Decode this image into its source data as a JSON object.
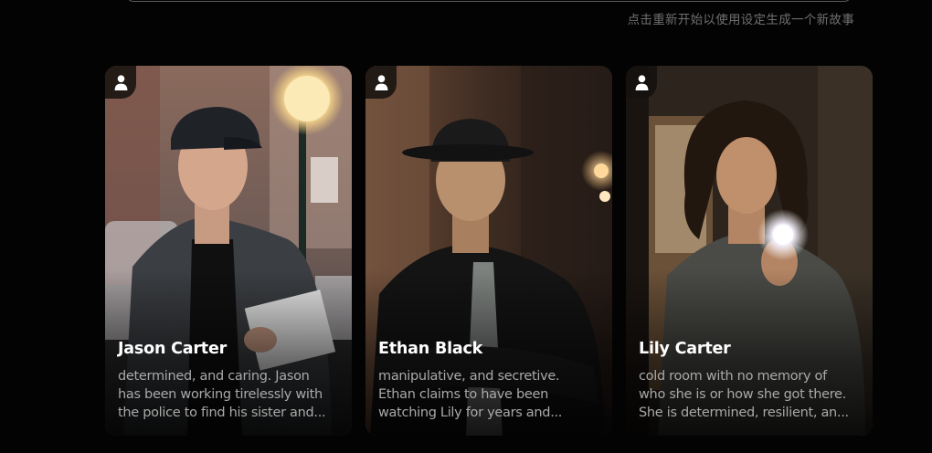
{
  "hint_text": "点击重新开始以使用设定生成一个新故事",
  "characters": [
    {
      "name": "Jason Carter",
      "desc_lines": [
        "determined, and caring. Jason",
        "has been working tirelessly with",
        "the police to find his sister and..."
      ]
    },
    {
      "name": "Ethan Black",
      "desc_lines": [
        "manipulative, and secretive.",
        "Ethan claims to have been",
        "watching Lily for years and..."
      ]
    },
    {
      "name": "Lily Carter",
      "desc_lines": [
        "cold room with no memory of",
        "who she is or how she got there.",
        "She is determined, resilient, an..."
      ]
    }
  ],
  "icons": {
    "avatar": "user-icon"
  },
  "colors": {
    "background": "#030303",
    "name_text": "#ffffff",
    "desc_text": "#a9a9a9",
    "hint_text": "#6f6f6f"
  }
}
